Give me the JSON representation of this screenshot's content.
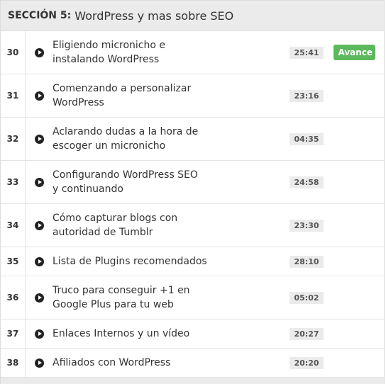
{
  "section": {
    "prefix": "SECCIÓN 5:",
    "title": "WordPress y mas sobre SEO"
  },
  "lessons": [
    {
      "number": "30",
      "title": "Eligiendo micronicho e instalando WordPress",
      "duration": "25:41",
      "badge": "Avance"
    },
    {
      "number": "31",
      "title": "Comenzando a personalizar WordPress",
      "duration": "23:16",
      "badge": ""
    },
    {
      "number": "32",
      "title": "Aclarando dudas a la hora de escoger un micronicho",
      "duration": "04:35",
      "badge": ""
    },
    {
      "number": "33",
      "title": "Configurando WordPress SEO y continuando",
      "duration": "24:58",
      "badge": ""
    },
    {
      "number": "34",
      "title": "Cómo capturar blogs con autoridad de Tumblr",
      "duration": "23:30",
      "badge": ""
    },
    {
      "number": "35",
      "title": "Lista de Plugins recomendados",
      "duration": "28:10",
      "badge": ""
    },
    {
      "number": "36",
      "title": "Truco para conseguir +1 en Google Plus para tu web",
      "duration": "05:02",
      "badge": ""
    },
    {
      "number": "37",
      "title": "Enlaces Internos y un vídeo",
      "duration": "20:27",
      "badge": ""
    },
    {
      "number": "38",
      "title": "Afiliados con WordPress",
      "duration": "20:20",
      "badge": ""
    }
  ],
  "icons": {
    "play": "play-circle-icon"
  },
  "colors": {
    "badge_bg": "#5cb85c",
    "header_bg": "#ebebeb",
    "duration_bg": "#ebebeb"
  }
}
